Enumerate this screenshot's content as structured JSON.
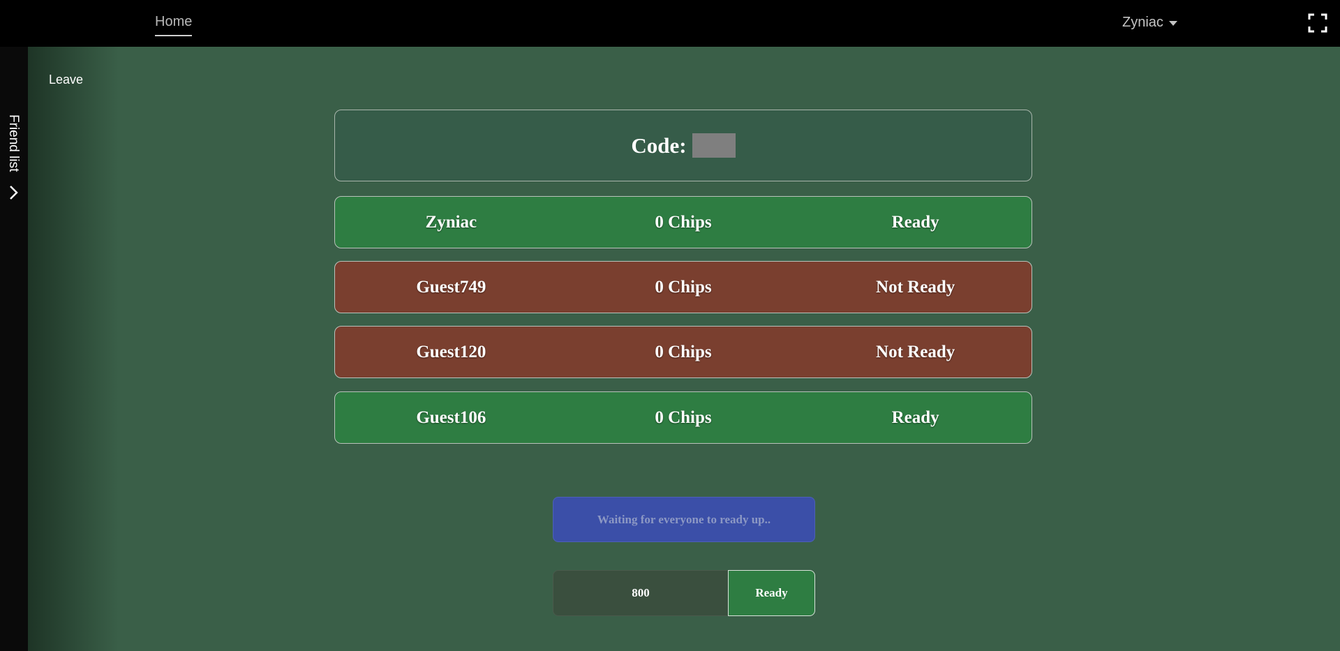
{
  "nav": {
    "home_label": "Home",
    "user_name": "Zyniac"
  },
  "sidebar": {
    "friend_list_label": "Friend list"
  },
  "lobby": {
    "leave_label": "Leave",
    "code_label": "Code:",
    "code_value": "",
    "players": [
      {
        "name": "Zyniac",
        "chips": "0 Chips",
        "status": "Ready",
        "is_ready": true
      },
      {
        "name": "Guest749",
        "chips": "0 Chips",
        "status": "Not Ready",
        "is_ready": false
      },
      {
        "name": "Guest120",
        "chips": "0 Chips",
        "status": "Not Ready",
        "is_ready": false
      },
      {
        "name": "Guest106",
        "chips": "0 Chips",
        "status": "Ready",
        "is_ready": true
      }
    ],
    "waiting_message": "Waiting for everyone to ready up..",
    "buy_in_value": "800",
    "ready_button_label": "Ready"
  },
  "colors": {
    "background": "#3a5f48",
    "ready": "#2e7d42",
    "not_ready": "#7a3f2f",
    "status_bar": "#3b4fa8"
  },
  "icons": {
    "user_menu": "chevron-down-icon",
    "fullscreen": "fullscreen-icon",
    "friend_toggle": "chevron-right-icon"
  }
}
